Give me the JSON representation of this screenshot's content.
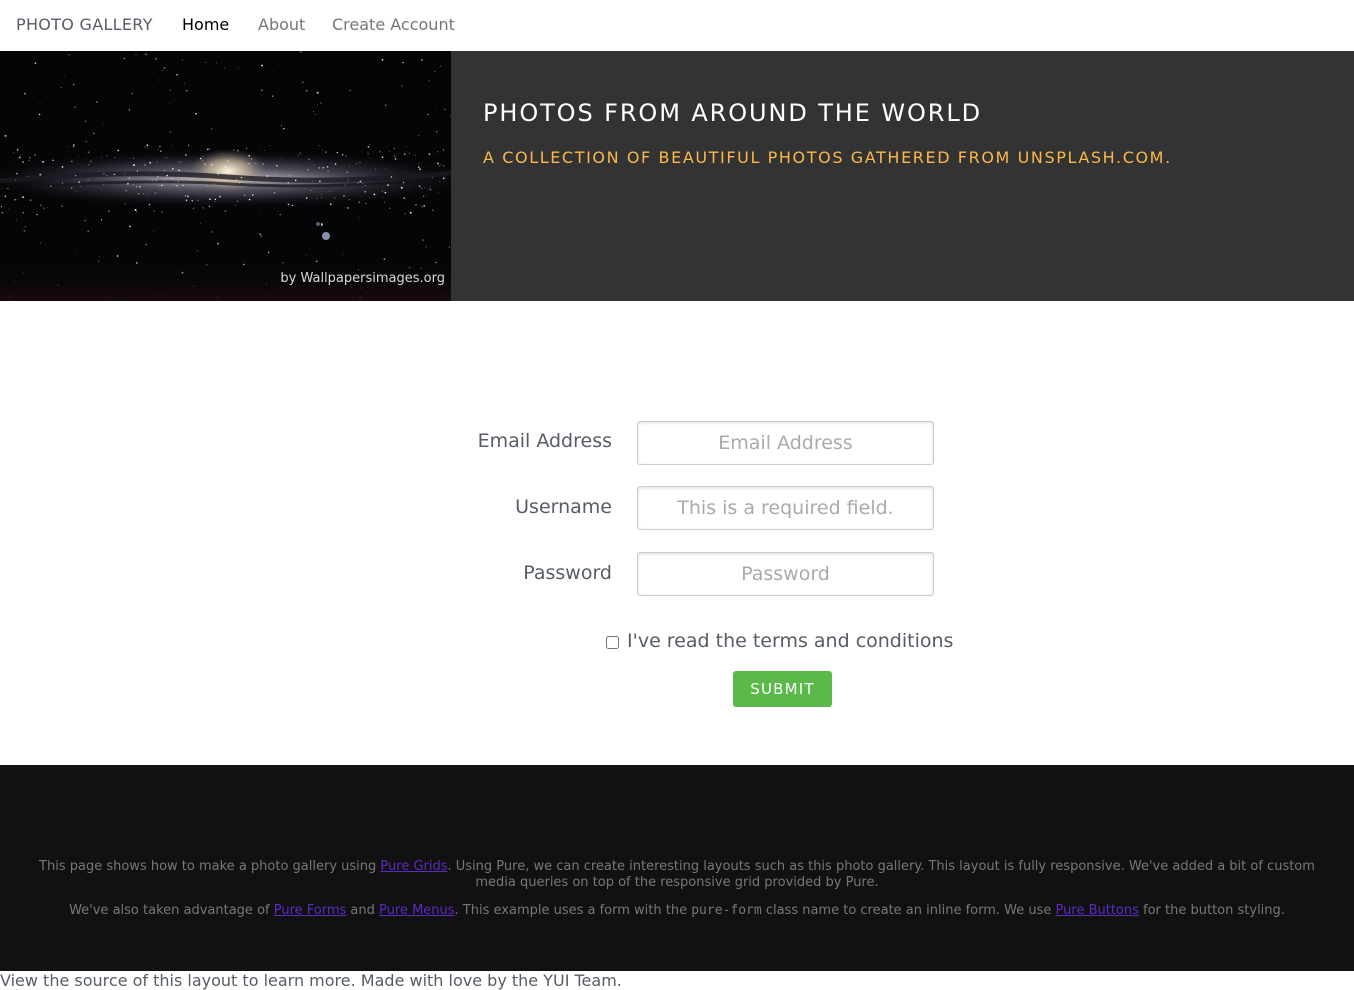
{
  "nav": {
    "brand": "PHOTO GALLERY",
    "items": [
      {
        "label": "Home",
        "active": true
      },
      {
        "label": "About",
        "active": false
      },
      {
        "label": "Create Account",
        "active": false
      }
    ]
  },
  "hero": {
    "photo_credit": "by Wallpapersimages.org",
    "title": "PHOTOS FROM AROUND THE WORLD",
    "subtitle": "A COLLECTION OF BEAUTIFUL PHOTOS GATHERED FROM UNSPLASH.COM."
  },
  "form": {
    "email": {
      "label": "Email Address",
      "placeholder": "Email Address"
    },
    "username": {
      "label": "Username",
      "placeholder": "This is a required field."
    },
    "password": {
      "label": "Password",
      "placeholder": "Password"
    },
    "terms_label": "I've read the terms and conditions",
    "terms_checked": false,
    "submit_label": "SUBMIT"
  },
  "footer": {
    "p1": {
      "t1": "This page shows how to make a photo gallery using ",
      "link1": "Pure Grids",
      "t2": ". Using Pure, we can create interesting layouts such as this photo gallery. This layout is fully responsive. We've added a bit of custom media queries on top of the responsive grid provided by Pure."
    },
    "p2": {
      "t1": "We've also taken advantage of ",
      "link1": "Pure Forms",
      "t2": " and ",
      "link2": "Pure Menus",
      "t3": ". This example uses a form with the ",
      "code": "pure-form",
      "t4": " class name to create an inline form. We use ",
      "link3": "Pure Buttons",
      "t5": " for the button styling."
    },
    "bottom_line": "View the source of this layout to learn more. Made with love by the YUI Team."
  },
  "colors": {
    "hero_bg": "#333333",
    "subtitle": "#fdb84a",
    "submit_bg": "#5bb94a",
    "footer_bg": "#111111",
    "link": "#5d2ac2"
  }
}
